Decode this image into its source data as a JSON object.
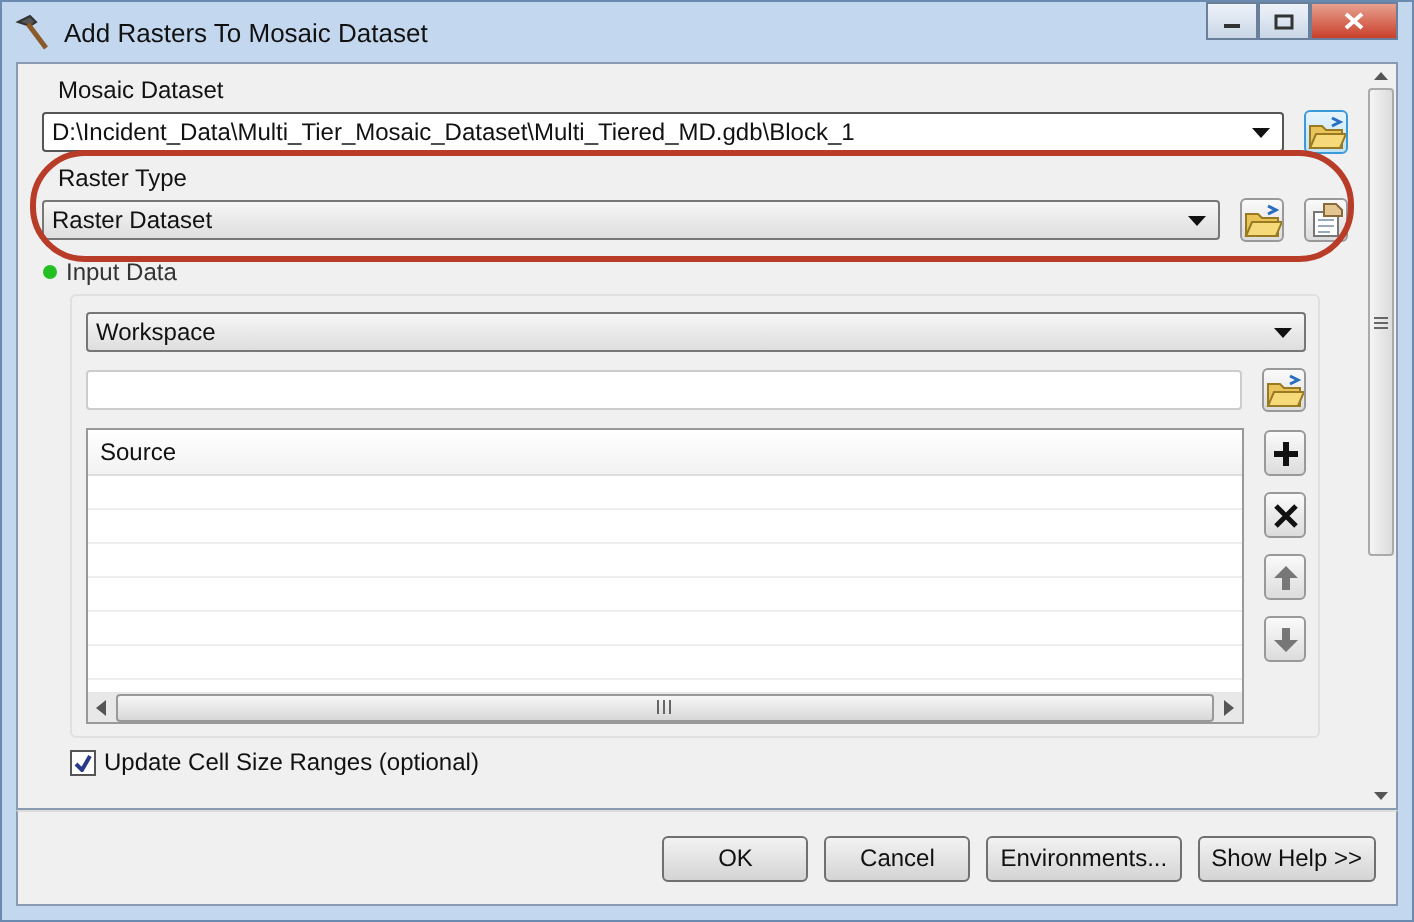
{
  "window": {
    "title": "Add Rasters To Mosaic Dataset"
  },
  "mosaic_dataset": {
    "label": "Mosaic Dataset",
    "value": "D:\\Incident_Data\\Multi_Tier_Mosaic_Dataset\\Multi_Tiered_MD.gdb\\Block_1"
  },
  "raster_type": {
    "label": "Raster Type",
    "value": "Raster Dataset",
    "highlighted": true
  },
  "input_data": {
    "label": "Input Data",
    "valid": true,
    "mode": "Workspace",
    "table": {
      "columns": [
        "Source"
      ]
    }
  },
  "update_cell_size": {
    "label": "Update Cell Size Ranges (optional)",
    "checked": true
  },
  "buttons": [
    {
      "label": "OK"
    },
    {
      "label": "Cancel"
    },
    {
      "label": "Environments..."
    },
    {
      "label": "Show Help >>"
    }
  ]
}
